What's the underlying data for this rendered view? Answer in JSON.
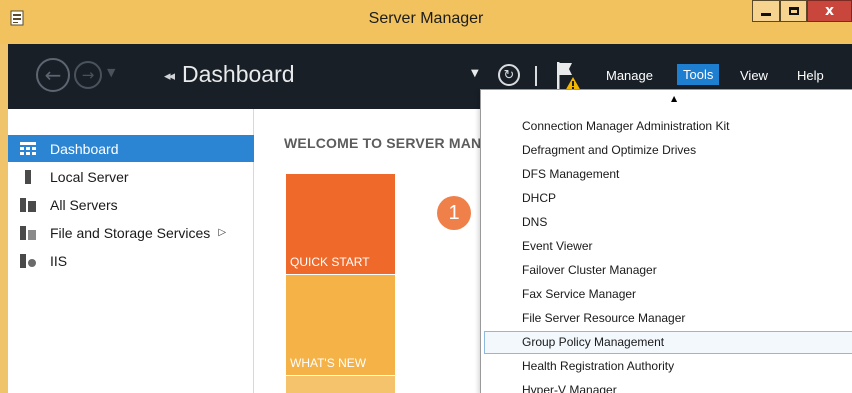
{
  "window": {
    "title": "Server Manager",
    "close_glyph": "x"
  },
  "navbar": {
    "back_glyph": "←",
    "forward_glyph": "→",
    "history_dropdown_glyph": "▼",
    "crumb_arrows": "◂◂",
    "page_title": "Dashboard",
    "refresh_dropdown_glyph": "▼",
    "refresh_glyph": "↻",
    "menu": {
      "manage": "Manage",
      "tools": "Tools",
      "view": "View",
      "help": "Help"
    }
  },
  "sidebar": {
    "items": [
      {
        "label": "Dashboard",
        "icon": "dashboard-icon",
        "active": true
      },
      {
        "label": "Local Server",
        "icon": "local-server-icon"
      },
      {
        "label": "All Servers",
        "icon": "all-servers-icon"
      },
      {
        "label": "File and Storage Services",
        "icon": "file-storage-icon",
        "expand_glyph": "▷"
      },
      {
        "label": "IIS",
        "icon": "iis-icon"
      }
    ]
  },
  "main": {
    "welcome": "WELCOME TO SERVER MAN",
    "tiles": {
      "quick_start": "QUICK START",
      "whats_new": "WHAT'S NEW"
    },
    "step_number": "1"
  },
  "tools_menu": {
    "scroll_up_glyph": "▲",
    "items": [
      "Connection Manager Administration Kit",
      "Defragment and Optimize Drives",
      "DFS Management",
      "DHCP",
      "DNS",
      "Event Viewer",
      "Failover Cluster Manager",
      "Fax Service Manager",
      "File Server Resource Manager",
      "Group Policy Management",
      "Health Registration Authority",
      "Hyper-V Manager"
    ],
    "hovered_item": "Group Policy Management"
  },
  "colors": {
    "titlebar": "#f1c25d",
    "navbar": "#181f27",
    "tools_highlight": "#1e7fd0",
    "sidebar_active": "#2b85d3",
    "tile_quick_start": "#ef6a2a",
    "tile_whats_new": "#f4b247",
    "close_button": "#c9463d"
  }
}
